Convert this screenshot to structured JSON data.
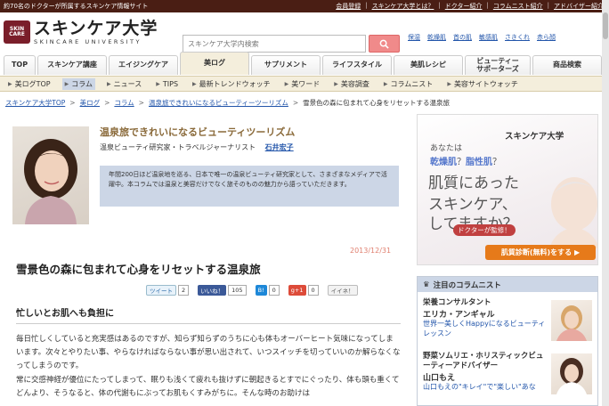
{
  "topbar": {
    "tagline": "約70名のドクターが所属するスキンケア情報サイト",
    "links": [
      "会員登録",
      "スキンケア大学とは？",
      "ドクター紹介",
      "コラムニスト紹介",
      "アドバイザー紹介"
    ]
  },
  "logo": {
    "badge_top": "SKIN",
    "badge_bottom": "CARE",
    "jp": "スキンケア大学",
    "en": "SKINCARE UNIVERSITY"
  },
  "search": {
    "placeholder": "スキンケア大学内検索"
  },
  "quick_links": [
    "保湿",
    "乾燥肌",
    "首の肌",
    "敏感肌",
    "さきくれ",
    "赤ら顔"
  ],
  "tabs": [
    {
      "label": "TOP"
    },
    {
      "label": "スキンケア講座"
    },
    {
      "label": "エイジングケア"
    },
    {
      "label": "美ログ"
    },
    {
      "label": "サプリメント"
    },
    {
      "label": "ライフスタイル"
    },
    {
      "label": "美肌レシピ"
    },
    {
      "label": "ビューティー\nサポーターズ"
    },
    {
      "label": "商品検索"
    }
  ],
  "subnav": [
    "美ログTOP",
    "コラム",
    "ニュース",
    "TIPS",
    "最新トレンドウォッチ",
    "美ワード",
    "美容調査",
    "コラムニスト",
    "美容サイトウォッチ"
  ],
  "breadcrumb": [
    "スキンケア大学TOP",
    "美ログ",
    "コラム",
    "温泉旅できれいになるビューティーツーリズム",
    "雪景色の森に包まれて心身をリセットする温泉旅"
  ],
  "column": {
    "title": "温泉旅できれいになるビューティツーリズム",
    "role": "温泉ビューティ研究家・トラベルジャーナリスト",
    "author": "石井宏子",
    "intro": "年間200日ほど温泉地を巡る、日本で唯一の温泉ビューティ研究家として、さまざまなメディアで活躍中。本コラムでは温泉と美容だけでなく旅そのものの魅力から語っていただきます。"
  },
  "article": {
    "date": "2013/12/31",
    "title": "雪景色の森に包まれて心身をリセットする温泉旅",
    "section": "忙しいとお肌へも負担に",
    "para1": "毎日忙しくしていると充実感はあるのですが、知らず知らずのうちに心も体もオーバーヒート気味になってしまいます。次々とやりたい事、やらなければならない事が思い出されて、いつスイッチを切っていいのか解らなくなってしまうのです。",
    "para2": "常に交感神経が優位にたってしまって、眠りも浅くて疲れも抜けずに朝起きるとすでにぐったり、体も頭も重くてどんより、そうなると、体の代謝もにぶってお肌もくすみがちに。そんな時のお助けは"
  },
  "share": [
    {
      "label": "ツイート",
      "count": "2",
      "color": "#e8f2fa",
      "text": "#2a6aa8"
    },
    {
      "label": "いいね！",
      "count": "105",
      "color": "#3b5998",
      "text": "#ffffff"
    },
    {
      "label": "B!",
      "count": "0",
      "color": "#1e88d8",
      "text": "#ffffff"
    },
    {
      "label": "g+1",
      "count": "0",
      "color": "#dd4b39",
      "text": "#ffffff"
    },
    {
      "label": "イイネ！",
      "count": "",
      "color": "#f2f2f2",
      "text": "#555555"
    }
  ],
  "ad": {
    "logo": "スキンケア大学",
    "line1": "あなたは",
    "line2a": "乾燥肌",
    "line2b": "？",
    "line2c": "脂性肌",
    "line2d": "？",
    "line3": "肌質にあった",
    "line4": "スキンケア、",
    "line5": "してますか？",
    "doctor": "ドクターが監修！",
    "cta": "肌質診断(無料)をする ▶"
  },
  "sidebar": {
    "heading": "注目のコラムニスト",
    "items": [
      {
        "role": "栄養コンサルタント",
        "name": "エリカ・アンギャル",
        "desc": "世界一美しくHappyになるビューティレッスン"
      },
      {
        "role": "野菜ソムリエ・ホリスティックビューティーアドバイザー",
        "name": "山口もえ",
        "desc": "山口もえの\"キレイ\"で\"楽しい\"あな"
      }
    ]
  },
  "colors": {
    "topbar": "#4a1e14",
    "accent_blue": "#ccd6e6",
    "link": "#2255aa",
    "date": "#e08070",
    "cta": "#e67a1a"
  }
}
